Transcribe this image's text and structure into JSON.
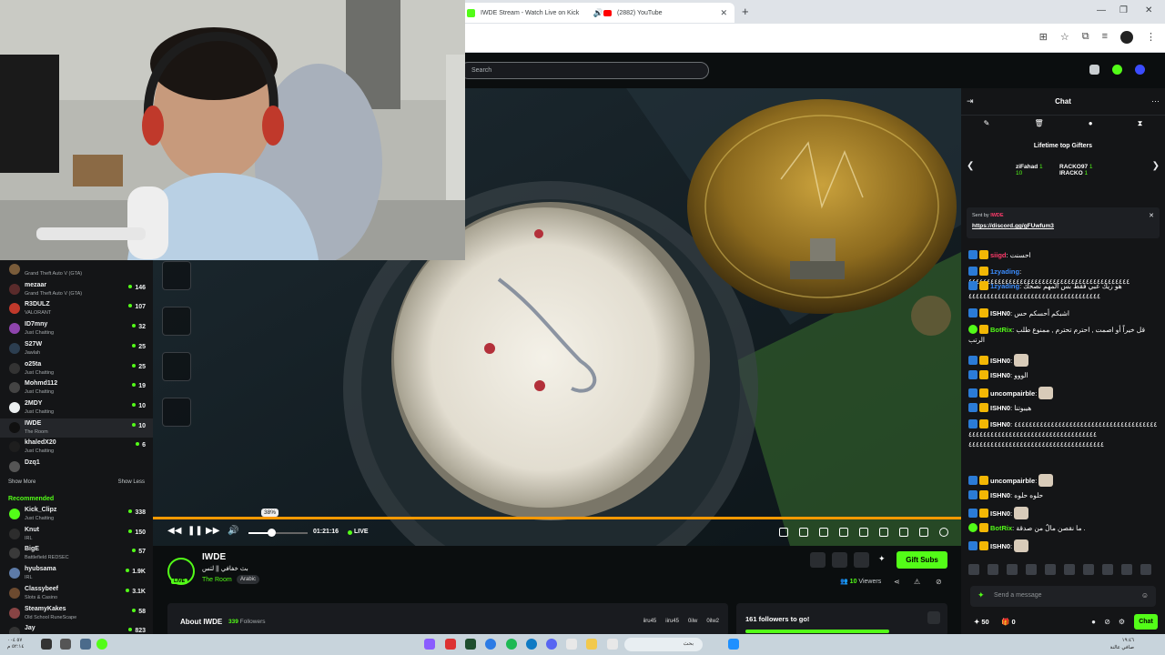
{
  "browser": {
    "tabs": [
      {
        "title": "IWDE Stream - Watch Live on Kick",
        "active": true
      },
      {
        "title": "(2882) YouTube",
        "active": false
      }
    ]
  },
  "header": {
    "search_placeholder": "Search"
  },
  "sidebar": {
    "following": [
      {
        "name": "",
        "sub": "Grand Theft Auto V (GTA)",
        "count": "",
        "color": "#7a5c3a"
      },
      {
        "name": "mezaar",
        "sub": "Grand Theft Auto V (GTA)",
        "count": "146",
        "color": "#5a2b2b"
      },
      {
        "name": "R3DULZ",
        "sub": "VALORANT",
        "count": "107",
        "color": "#c0392b"
      },
      {
        "name": "ID7mny",
        "sub": "Just Chatting",
        "count": "32",
        "color": "#8e44ad"
      },
      {
        "name": "S27W",
        "sub": "Jawlah",
        "count": "25",
        "color": "#2c3e50"
      },
      {
        "name": "o25ta",
        "sub": "Just Chatting",
        "count": "25",
        "color": "#333333"
      },
      {
        "name": "Mohmd112",
        "sub": "Just Chatting",
        "count": "19",
        "color": "#444444"
      },
      {
        "name": "2MDY",
        "sub": "Just Chatting",
        "count": "10",
        "color": "#ecf0f1"
      },
      {
        "name": "IWDE",
        "sub": "The Room",
        "count": "10",
        "color": "#101010"
      },
      {
        "name": "khaledX20",
        "sub": "Just Chatting",
        "count": "6",
        "color": "#1e1e1e"
      },
      {
        "name": "Dzq1",
        "sub": "",
        "count": "",
        "color": "#555555"
      }
    ],
    "show_more": "Show More",
    "show_less": "Show Less",
    "recommended_label": "Recommended",
    "recommended": [
      {
        "name": "Kick_Clipz",
        "sub": "Just Chatting",
        "count": "338",
        "color": "#53fc18"
      },
      {
        "name": "Knut",
        "sub": "IRL",
        "count": "150",
        "color": "#2d2d2d"
      },
      {
        "name": "BigE",
        "sub": "Battlefield REDSEC",
        "count": "57",
        "color": "#3a3a3a"
      },
      {
        "name": "hyubsama",
        "sub": "IRL",
        "count": "1.9K",
        "color": "#5d7ba8"
      },
      {
        "name": "Classybeef",
        "sub": "Slots & Casino",
        "count": "3.1K",
        "color": "#6c4a2f"
      },
      {
        "name": "SteamyKakes",
        "sub": "Old School RuneScape",
        "count": "58",
        "color": "#884444"
      },
      {
        "name": "Jay",
        "sub": "",
        "count": "823",
        "color": "#333333"
      }
    ]
  },
  "player": {
    "volume_tooltip": "38%",
    "volume_fraction": 0.38,
    "timecode": "01:21:16",
    "live_label": "LIVE"
  },
  "stream": {
    "name": "IWDE",
    "title": "بث خفافي || لتس",
    "category": "The Room",
    "language": "Arabic",
    "gift_label": "Gift Subs",
    "viewers_count": "10",
    "viewers_label": "Viewers",
    "live_badge": "LIVE",
    "about_title": "About IWDE",
    "followers_count": "339",
    "followers_label": "Followers",
    "socials": [
      "iiru45",
      "iiru45",
      "0ilw",
      "0ilw2"
    ],
    "goal_text": "161 followers to go!",
    "goal_fraction": 0.9
  },
  "chat": {
    "title": "Chat",
    "gifters_title": "Lifetime top Gifters",
    "gifters": [
      {
        "name": "ziFahad",
        "count": "1",
        "sub": "10"
      },
      {
        "name": "RACKO97",
        "count": "1",
        "sub": ""
      },
      {
        "name": "IRACKO",
        "count": "1",
        "sub": ""
      }
    ],
    "pinned_by_label": "Sent by",
    "pinned_by": "IWDE",
    "pinned_link": "https://discord.gg/gFUwfum3",
    "messages": [
      {
        "user": "siigd",
        "color": "#ff3b6b",
        "text": "احسنت"
      },
      {
        "user": "1zyading",
        "color": "#3b8dff",
        "text": "٤٤٤٤٤٤٤٤٤٤٤٤٤٤٤٤٤٤٤٤٤٤٤٤٤٤٤٤٤٤٤٤٤٤٤٤٤٤٤٤٤٤٤٤"
      },
      {
        "user": "1zyading",
        "color": "#3b8dff",
        "text": "هو زيك عبي فقط بس المهم نصحك ٤٤٤٤٤٤٤٤٤٤٤٤٤٤٤٤٤٤٤٤٤٤٤٤٤٤٤٤٤٤٤٤٤٤٤٤"
      },
      {
        "user": "ISHN0",
        "color": "#ffffff",
        "text": "اشبكم أحسكم حس"
      },
      {
        "user": "BotRix",
        "color": "#53fc18",
        "text": "قل خيراً أو اصمت , احترم تحترم , ممنوع طلب الرتب"
      },
      {
        "user": "ISHN0",
        "color": "#ffffff",
        "text": ""
      },
      {
        "user": "ISHN0",
        "color": "#ffffff",
        "text": "الووو"
      },
      {
        "user": "uncompairble",
        "color": "#ffffff",
        "text": ""
      },
      {
        "user": "ISHN0",
        "color": "#ffffff",
        "text": "هيبوتنا"
      },
      {
        "user": "ISHN0",
        "color": "#ffffff",
        "text": "٤٤٤٤٤٤٤٤٤٤٤٤٤٤٤٤٤٤٤٤٤٤٤٤٤٤٤٤٤٤٤٤٤٤٤٤٤٤٤ ٤٤٤٤٤٤٤٤٤٤٤٤٤٤٤٤٤٤٤٤٤٤٤٤٤٤٤٤٤٤٤٤٤٤٤ ٤٤٤٤٤٤٤٤٤٤٤٤٤٤٤٤٤٤٤٤٤٤٤٤٤٤٤٤٤٤٤٤٤٤٤٤٤"
      },
      {
        "user": "uncompairble",
        "color": "#ffffff",
        "text": ""
      },
      {
        "user": "ISHN0",
        "color": "#ffffff",
        "text": "حلوه حلوه"
      },
      {
        "user": "ISHN0",
        "color": "#ffffff",
        "text": ""
      },
      {
        "user": "BotRix",
        "color": "#53fc18",
        "text": "ما نقصن مالٌ من صدقة ."
      },
      {
        "user": "ISHN0",
        "color": "#ffffff",
        "text": ""
      }
    ],
    "input_placeholder": "Send a message",
    "points": "50",
    "subs": "0",
    "send_label": "Chat"
  },
  "taskbar": {
    "search_text": "بحث",
    "clock_time": "١٩:٤٦",
    "clock_date": "صافي عالنة",
    "left_line1": "٥٧ ٠٠٤",
    "left_line2": "٥٢:١٤ م"
  },
  "colors": {
    "accent": "#53fc18",
    "progress": "#ff9900"
  }
}
